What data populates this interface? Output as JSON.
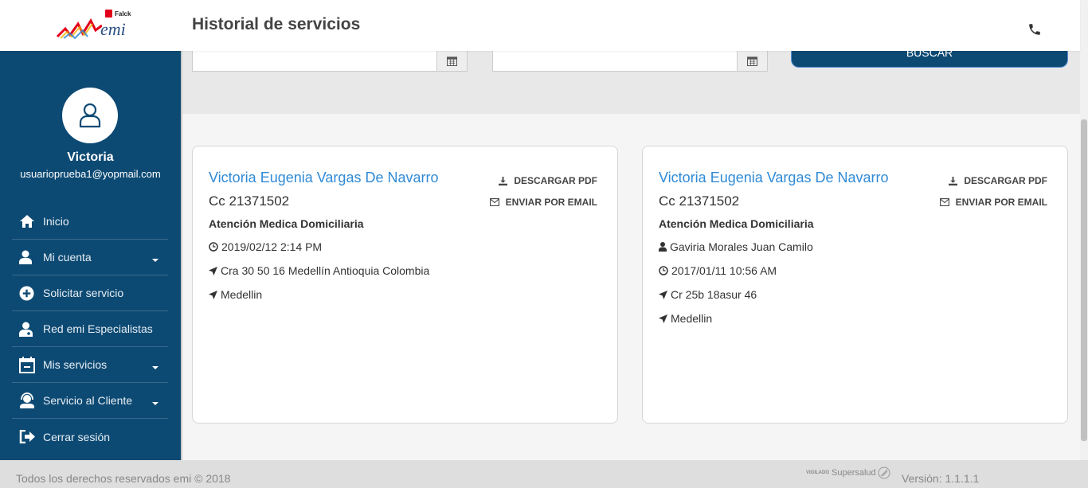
{
  "header": {
    "title": "Historial de servicios",
    "logo_brand": "emi",
    "logo_parent": "Falck"
  },
  "sidebar": {
    "user": {
      "name": "Victoria",
      "email": "usuarioprueba1@yopmail.com"
    },
    "items": [
      {
        "label": "Inicio",
        "icon": "home-icon"
      },
      {
        "label": "Mi cuenta",
        "icon": "user-icon",
        "has_submenu": true
      },
      {
        "label": "Solicitar servicio",
        "icon": "plus-circle-icon"
      },
      {
        "label": "Red emi Especialistas",
        "icon": "doctor-icon"
      },
      {
        "label": "Mis servicios",
        "icon": "calendar-icon",
        "has_submenu": true
      },
      {
        "label": "Servicio al Cliente",
        "icon": "headset-icon",
        "has_submenu": true
      },
      {
        "label": "Cerrar sesión",
        "icon": "sign-out-icon"
      }
    ]
  },
  "filters": {
    "date_from_value": "",
    "date_to_value": "",
    "search_label": "BUSCAR"
  },
  "cards": [
    {
      "name": "Victoria Eugenia Vargas De Navarro",
      "cc": "Cc 21371502",
      "service_type": "Atención Medica Domiciliaria",
      "details": [
        {
          "icon": "clock-icon",
          "text": "2019/02/12 2:14 PM"
        },
        {
          "icon": "location-arrow-icon",
          "text": "Cra 30 50 16 Medellín Antioquia Colombia"
        },
        {
          "icon": "location-arrow-icon",
          "text": "Medellin"
        }
      ],
      "download_label": "DESCARGAR PDF",
      "email_label": "ENVIAR POR EMAIL"
    },
    {
      "name": "Victoria Eugenia Vargas De Navarro",
      "cc": "Cc 21371502",
      "service_type": "Atención Medica Domiciliaria",
      "details": [
        {
          "icon": "user-icon",
          "text": "Gaviria Morales Juan Camilo"
        },
        {
          "icon": "clock-icon",
          "text": "2017/01/11 10:56 AM"
        },
        {
          "icon": "location-arrow-icon",
          "text": "Cr 25b 18asur 46"
        },
        {
          "icon": "location-arrow-icon",
          "text": "Medellin"
        }
      ],
      "download_label": "DESCARGAR PDF",
      "email_label": "ENVIAR POR EMAIL"
    }
  ],
  "footer": {
    "copyright": "Todos los derechos reservados emi © 2018",
    "vigilado_small": "VIGILADO",
    "vigilado_brand": "Supersalud",
    "version": "Versión: 1.1.1.1"
  },
  "colors": {
    "sidebar_bg": "#0d4a73",
    "link_blue": "#2f8ad6",
    "falck_red": "#e3001b"
  }
}
